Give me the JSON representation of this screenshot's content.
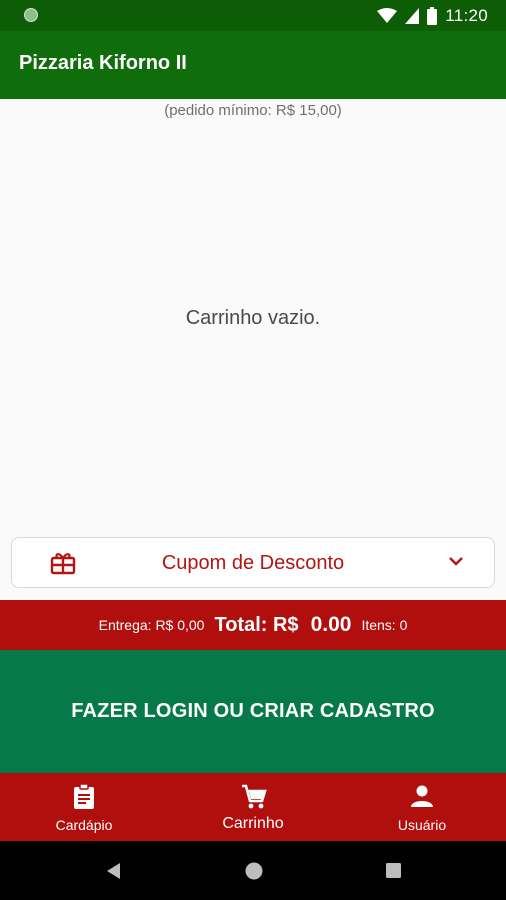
{
  "status_bar": {
    "time": "11:20"
  },
  "app_bar": {
    "title": "Pizzaria Kiforno II"
  },
  "cart": {
    "minimum_order": "(pedido mínimo: R$ 15,00)",
    "empty_message": "Carrinho vazio."
  },
  "coupon": {
    "label": "Cupom de Desconto"
  },
  "totals": {
    "delivery": "Entrega: R$ 0,00",
    "total_label": "Total: R$",
    "total_value": "0.00",
    "items": "Itens: 0"
  },
  "login_button": {
    "label": "FAZER LOGIN OU CRIAR CADASTRO"
  },
  "bottom_nav": {
    "items": [
      {
        "label": "Cardápio",
        "icon": "clipboard-icon"
      },
      {
        "label": "Carrinho",
        "icon": "cart-icon",
        "active": true
      },
      {
        "label": "Usuário",
        "icon": "person-icon"
      }
    ]
  },
  "colors": {
    "status_bar": "#0d5c06",
    "app_bar": "#0f6d0b",
    "accent_red": "#b10f0e",
    "login_green": "#067949",
    "coupon_text": "#b51414"
  }
}
